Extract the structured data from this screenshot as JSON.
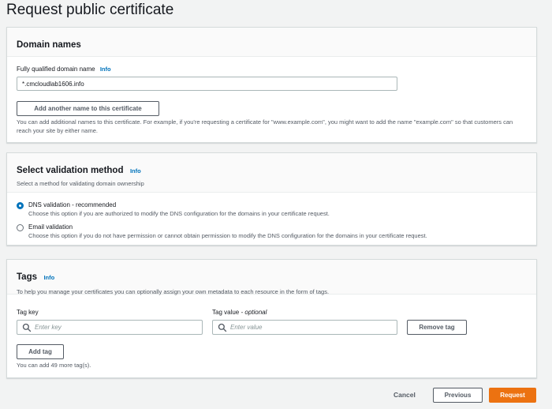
{
  "page": {
    "title": "Request public certificate"
  },
  "domain_card": {
    "title": "Domain names",
    "field_label": "Fully qualified domain name",
    "info_label": "Info",
    "domain_value": "*.cmcloudlab1606.info",
    "add_name_label": "Add another name to this certificate",
    "help_text": "You can add additional names to this certificate. For example, if you're requesting a certificate for \"www.example.com\", you might want to add the name \"example.com\" so that customers can reach your site by either name."
  },
  "validation_card": {
    "title": "Select validation method",
    "info_label": "Info",
    "subtitle": "Select a method for validating domain ownership",
    "options": [
      {
        "label": "DNS validation - recommended",
        "description": "Choose this option if you are authorized to modify the DNS configuration for the domains in your certificate request.",
        "selected": true
      },
      {
        "label": "Email validation",
        "description": "Choose this option if you do not have permission or cannot obtain permission to modify the DNS configuration for the domains in your certificate request.",
        "selected": false
      }
    ]
  },
  "tags_card": {
    "title": "Tags",
    "info_label": "Info",
    "subtitle": "To help you manage your certificates you can optionally assign your own metadata to each resource in the form of tags.",
    "tag_key_label": "Tag key",
    "tag_value_label": "Tag value",
    "tag_value_optional": "- optional",
    "tag_key_placeholder": "Enter key",
    "tag_value_placeholder": "Enter value",
    "remove_tag_label": "Remove tag",
    "add_tag_label": "Add tag",
    "remaining_text": "You can add 49 more tag(s)."
  },
  "footer": {
    "cancel_label": "Cancel",
    "previous_label": "Previous",
    "request_label": "Request"
  },
  "colors": {
    "primary": "#ec7211",
    "link": "#0073bb",
    "radio_selected": "#0073bb"
  },
  "icons": {
    "search": "search-icon"
  }
}
